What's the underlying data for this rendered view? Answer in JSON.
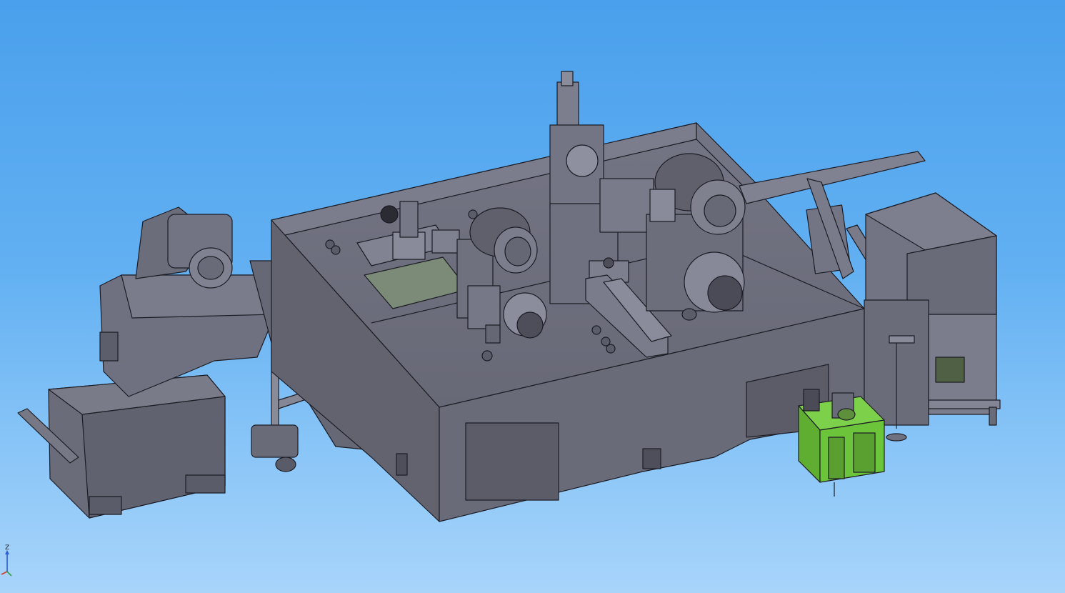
{
  "viewport": {
    "background_top": "#4aa0ec",
    "background_bottom": "#a8d4fa"
  },
  "model": {
    "body_color": "#6e6f7d",
    "edge_color": "#1c1c24",
    "accent_green": "#6cc43a"
  },
  "triad": {
    "z_label": "Z",
    "icon": "axis-triad-icon"
  }
}
